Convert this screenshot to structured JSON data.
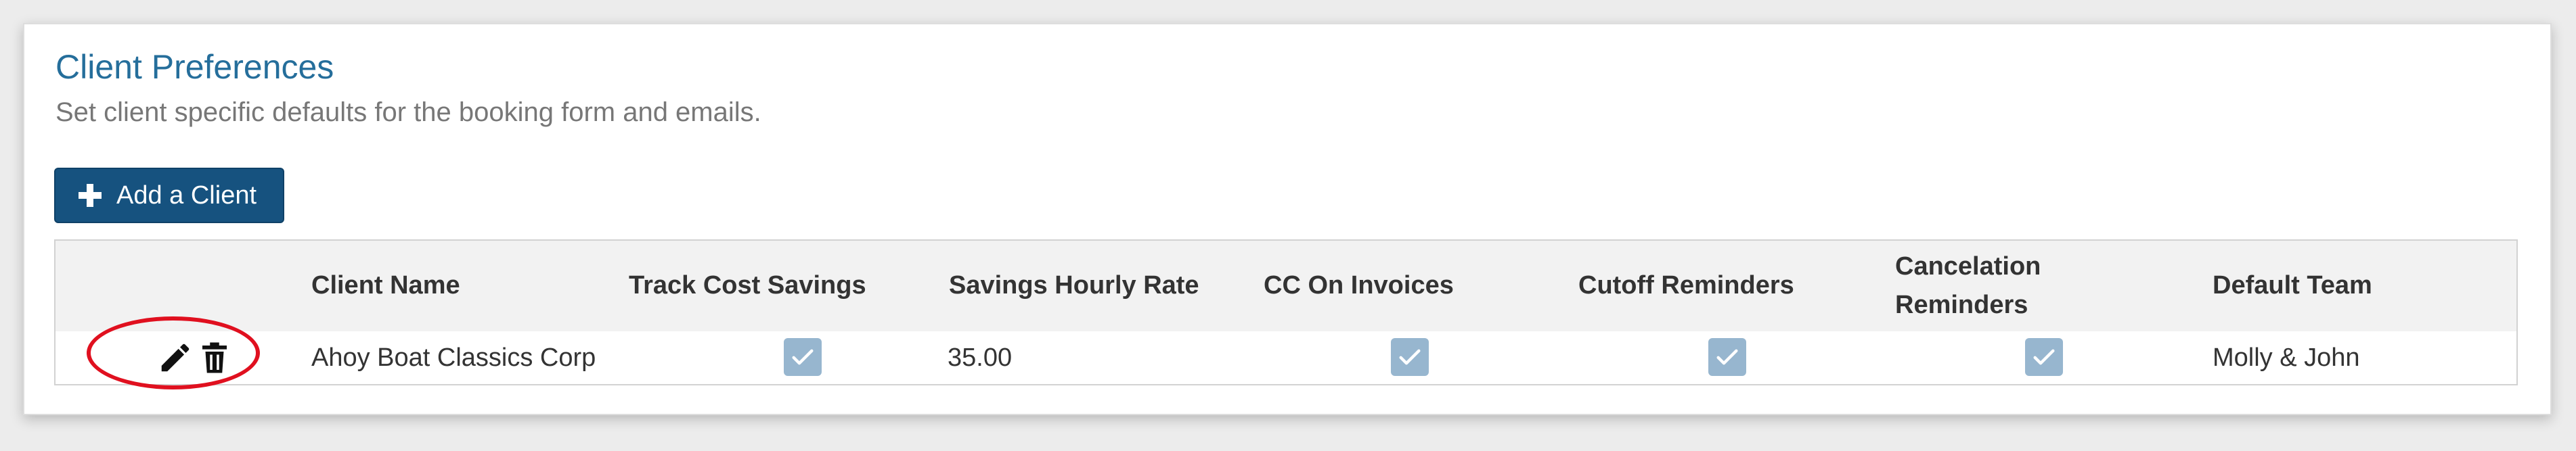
{
  "section": {
    "title": "Client Preferences",
    "subtitle": "Set client specific defaults for the booking form and emails."
  },
  "toolbar": {
    "add_client_label": "Add a Client",
    "add_icon": "plus-icon"
  },
  "table": {
    "columns": {
      "client_name": "Client Name",
      "track_cost_savings": "Track Cost Savings",
      "savings_hourly_rate": "Savings Hourly Rate",
      "cc_on_invoices": "CC On Invoices",
      "cutoff_reminders": "Cutoff Reminders",
      "cancelation_reminders_line1": "Cancelation",
      "cancelation_reminders_line2": "Reminders",
      "default_team": "Default Team"
    },
    "rows": [
      {
        "actions": [
          "pencil-icon",
          "trash-icon"
        ],
        "client_name": "Ahoy Boat Classics Corp",
        "track_cost_savings": true,
        "savings_hourly_rate": "35.00",
        "cc_on_invoices": true,
        "cutoff_reminders": true,
        "cancelation_reminders": true,
        "default_team": "Molly & John"
      }
    ]
  },
  "colors": {
    "title": "#256e9b",
    "button_bg": "#16527f",
    "checkbox_bg": "#97b6cf",
    "annotation": "#e0101f"
  }
}
